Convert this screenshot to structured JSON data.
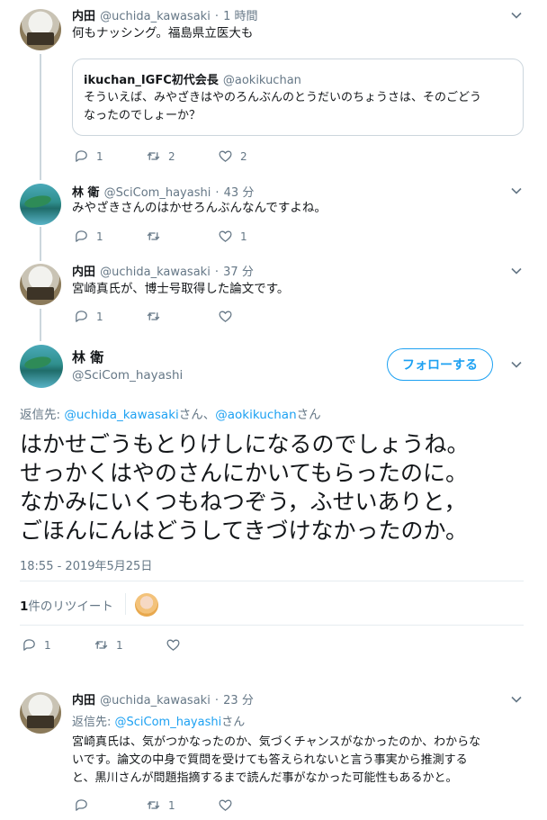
{
  "tweets": [
    {
      "author_name": "内田",
      "author_handle": "@uchida_kawasaki",
      "separator": "·",
      "time": "1 時間",
      "text": "何もナッシング。福島県立医大も",
      "quote": {
        "author_name": "ikuchan_IGFC初代会長",
        "author_handle": "@aokikuchan",
        "text_line1": "そういえば、みやざきはやのろんぶんのとうだいのちょうさは、そのごどう",
        "text_line2": "なったのでしょーか？"
      },
      "reply_count": "1",
      "retweet_count": "2",
      "like_count": "2"
    },
    {
      "author_name": "林 衛",
      "author_handle": "@SciCom_hayashi",
      "separator": "·",
      "time": "43 分",
      "text": "みやざきさんのはかせろんぶんなんですよね。",
      "reply_count": "1",
      "retweet_count": "",
      "like_count": "1"
    },
    {
      "author_name": "内田",
      "author_handle": "@uchida_kawasaki",
      "separator": "·",
      "time": "37 分",
      "text": "宮崎真氏が、博士号取得した論文です。",
      "reply_count": "1",
      "retweet_count": "",
      "like_count": ""
    }
  ],
  "main_tweet": {
    "author_name": "林 衛",
    "author_handle": "@SciCom_hayashi",
    "follow_label": "フォローする",
    "reply_to_prefix": "返信先: ",
    "reply_to_user1": "@uchida_kawasaki",
    "reply_to_mid": "さん、",
    "reply_to_user2": "@aokikuchan",
    "reply_to_suffix": "さん",
    "text_line1": "はかせごうもとりけしになるのでしょうね。",
    "text_line2": "せっかくはやのさんにかいてもらったのに。",
    "text_line3": "なかみにいくつもねつぞう，ふせいありと，",
    "text_line4": "ごほんにんはどうしてきづけなかったのか。",
    "timestamp": "18:55 - 2019年5月25日",
    "retweets_count": "1",
    "retweets_label": "件のリツイート",
    "reply_count": "1",
    "retweet_count": "1",
    "like_count": ""
  },
  "reply": {
    "author_name": "内田",
    "author_handle": "@uchida_kawasaki",
    "separator": "·",
    "time": "23 分",
    "reply_to_prefix": "返信先: ",
    "reply_to_user": "@SciCom_hayashi",
    "reply_to_suffix": "さん",
    "text_line1": "宮崎真氏は、気がつかなったのか、気づくチャンスがなかったのか、わからな",
    "text_line2": "いです。論文の中身で質問を受けても答えられないと言う事実から推測する",
    "text_line3": "と、黒川さんが問題指摘するまで読んだ事がなかった可能性もあるかと。",
    "reply_count": "",
    "retweet_count": "1",
    "like_count": ""
  },
  "colors": {
    "accent": "#1da1f2",
    "secondary_text": "#657786",
    "border": "#ccd6dd"
  },
  "icons": [
    "reply-icon",
    "retweet-icon",
    "like-icon",
    "chevron-down-icon"
  ]
}
